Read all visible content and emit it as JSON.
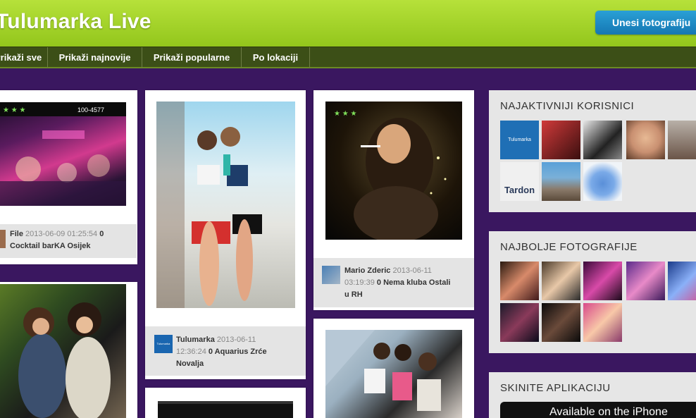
{
  "header": {
    "title": "Tulumarka Live",
    "upload_label": "Unesi fotografiju"
  },
  "nav": {
    "items": [
      "Prikaži sve",
      "Prikaži najnovije",
      "Prikaži popularne",
      "Po lokaciji"
    ]
  },
  "photo_overlay": {
    "counter": "100-4577"
  },
  "posts": [
    {
      "author": "File",
      "datetime": "2013-06-09 01:25:54",
      "count": "0",
      "location": "Cocktail barKA Osijek"
    },
    {
      "author": "Tulumarka",
      "datetime_date": "2013-06-11",
      "datetime_time": "12:36:24",
      "count": "0",
      "location_a": "Aquarius Zrće",
      "location_b": "Novalja",
      "avatar_text": "Tulumarka"
    },
    {
      "author": "Mario Zderic",
      "datetime_date": "2013-06-11",
      "datetime_time": "03:19:39",
      "count": "0",
      "location_a": "Nema kluba Ostali",
      "location_b": "u RH"
    }
  ],
  "sidebar": {
    "active_users_title": "NAJAKTIVNIJI KORISNICI",
    "active_users_thumb_text": "Tulumarka",
    "tardon_text": "Tardon",
    "best_photos_title": "NAJBOLJE FOTOGRAFIJE",
    "app_title": "SKINITE APLIKACIJU",
    "app_badge": "Available on the iPhone"
  },
  "colors": {
    "header_green": "#a5d42b",
    "nav_dark": "#3c4f17",
    "background_purple": "#3a1760",
    "button_blue": "#1f8cc6"
  }
}
